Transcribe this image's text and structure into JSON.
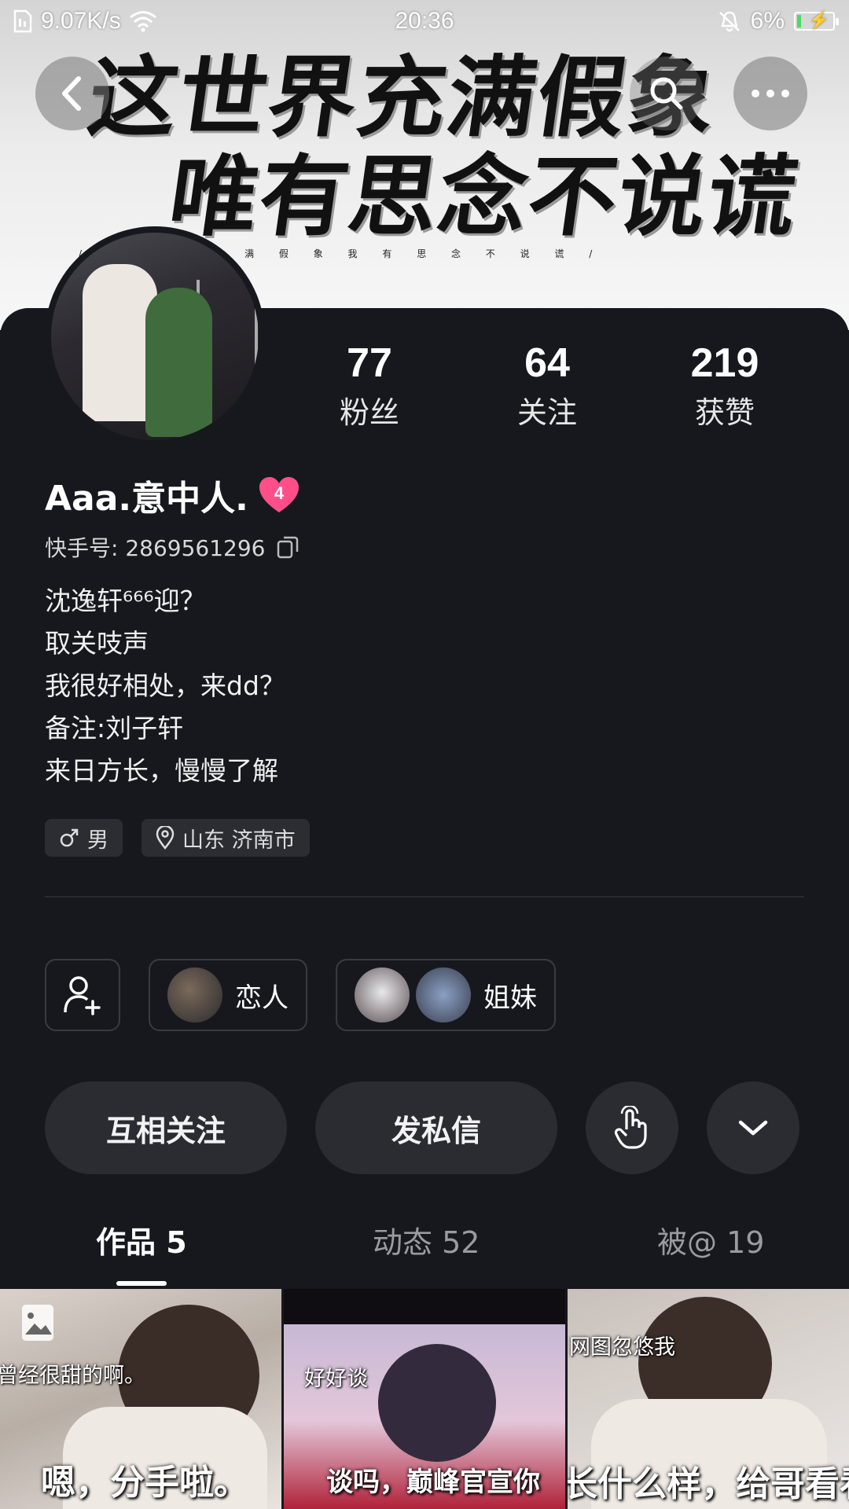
{
  "status_bar": {
    "network_speed": "9.07K/s",
    "time": "20:36",
    "battery": "6%"
  },
  "banner": {
    "line1": "这世界充满假象",
    "line2": "唯有思念不说谎",
    "small": "/ 这 世 界 充 满 假 象   我 有 思 念 不 说 谎 /"
  },
  "stats": [
    {
      "value": "77",
      "label": "粉丝"
    },
    {
      "value": "64",
      "label": "关注"
    },
    {
      "value": "219",
      "label": "获赞"
    }
  ],
  "profile": {
    "name": "Aaa.意中人.",
    "badge_level": "4",
    "kuaishou_id": "快手号: 2869561296",
    "bio": [
      "沈逸轩⁶⁶⁶迎？",
      "取关吱声",
      "我很好相处，来dd？",
      "备注:刘子轩",
      "来日方长，慢慢了解"
    ],
    "gender_tag": "男",
    "location_tag": "山东 济南市"
  },
  "relations": {
    "lover": "恋人",
    "sisters": "姐妹"
  },
  "actions": {
    "mutual_follow": "互相关注",
    "message": "发私信"
  },
  "tabs": [
    {
      "label": "作品 5"
    },
    {
      "label": "动态 52"
    },
    {
      "label": "被@ 19"
    }
  ],
  "thumbs": [
    {
      "top_caption": "曾经很甜的啊。",
      "big_caption": "嗯，分手啦。"
    },
    {
      "top_caption": "好好谈",
      "big_caption": "谈吗，巅峰官宣你"
    },
    {
      "top_caption": "网图忽悠我",
      "big_caption": "长什么样，给哥看看"
    }
  ],
  "colors": {
    "background": "#17181d",
    "button": "#2b2c31",
    "badge_pink": "#ff4f8a"
  }
}
